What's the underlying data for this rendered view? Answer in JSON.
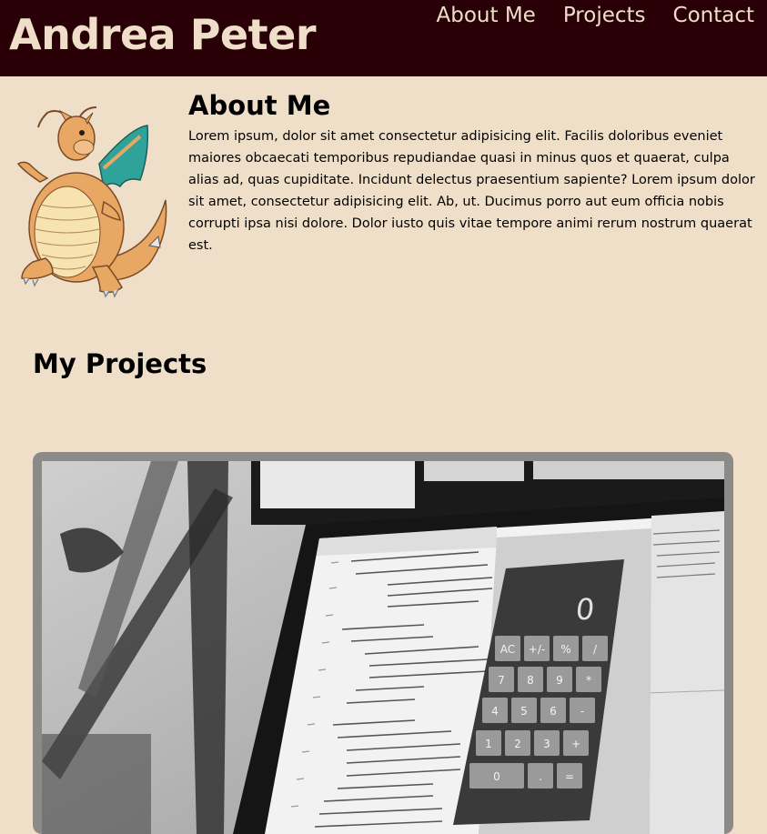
{
  "header": {
    "site_title": "Andrea Peter",
    "nav": [
      "About Me",
      "Projects",
      "Contact"
    ]
  },
  "about": {
    "title": "About Me",
    "text": "Lorem ipsum, dolor sit amet consectetur adipisicing elit. Facilis doloribus eveniet maiores obcaecati temporibus repudiandae quasi in minus quos et quaerat, culpa alias ad, quas cupiditate. Incidunt delectus praesentium sapiente? Lorem ipsum dolor sit amet, consectetur adipisicing elit. Ab, ut. Ducimus porro aut eum officia nobis corrupti ipsa nisi dolore. Dolor iusto quis vitae tempore animi rerum nostrum quaerat est."
  },
  "projects": {
    "title": "My Projects"
  },
  "calculator": {
    "display": "0",
    "keys": [
      "AC",
      "+/-",
      "%",
      "/",
      "7",
      "8",
      "9",
      "*",
      "4",
      "5",
      "6",
      "-",
      "1",
      "2",
      "3",
      "+",
      "0",
      ".",
      "="
    ]
  },
  "colors": {
    "header_bg": "#280005",
    "page_bg": "#efdfc9",
    "header_text": "#efdfc9",
    "card_border": "#8c8a88"
  }
}
